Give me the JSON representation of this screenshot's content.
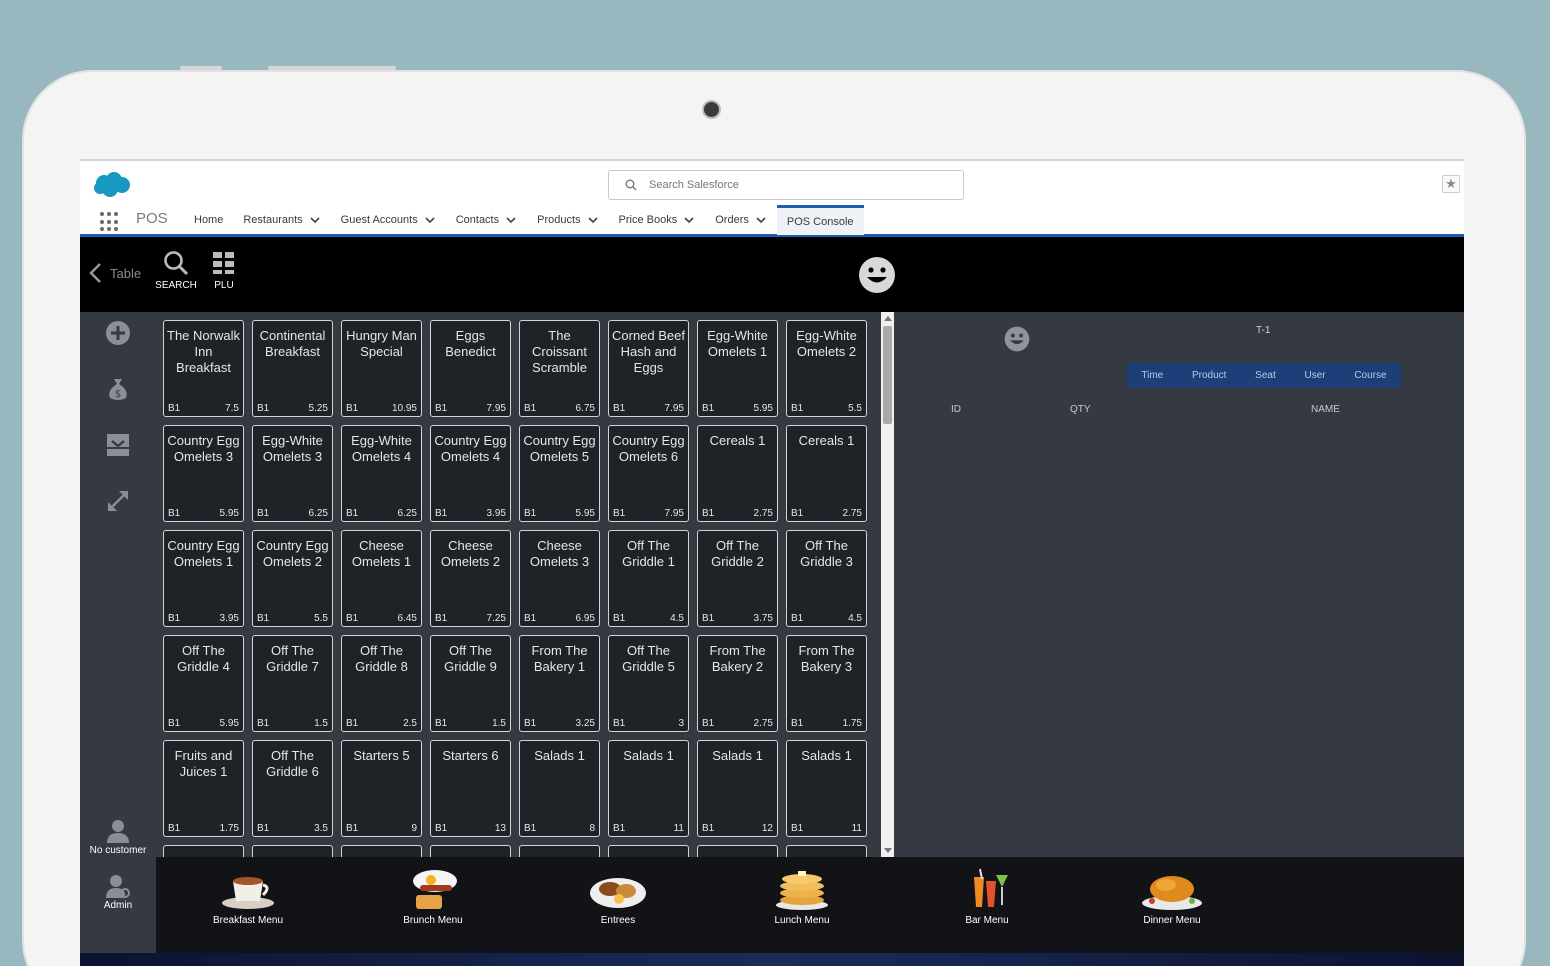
{
  "sf": {
    "search_placeholder": "Search Salesforce",
    "app_name": "POS",
    "nav": [
      {
        "label": "Home",
        "dropdown": false
      },
      {
        "label": "Restaurants",
        "dropdown": true
      },
      {
        "label": "Guest Accounts",
        "dropdown": true
      },
      {
        "label": "Contacts",
        "dropdown": true
      },
      {
        "label": "Products",
        "dropdown": true
      },
      {
        "label": "Price Books",
        "dropdown": true
      },
      {
        "label": "Orders",
        "dropdown": true
      },
      {
        "label": "POS Console",
        "dropdown": false,
        "active": true
      }
    ]
  },
  "toolbar": {
    "back_label": "Table",
    "search_label": "SEARCH",
    "plu_label": "PLU"
  },
  "rail": {
    "customer_label": "No customer",
    "admin_label": "Admin"
  },
  "tiles": [
    {
      "name": "The Norwalk Inn Breakfast",
      "code": "B1",
      "price": "7.5"
    },
    {
      "name": "Continental Breakfast",
      "code": "B1",
      "price": "5.25"
    },
    {
      "name": "Hungry Man Special",
      "code": "B1",
      "price": "10.95"
    },
    {
      "name": "Eggs Benedict",
      "code": "B1",
      "price": "7.95"
    },
    {
      "name": "The Croissant Scramble",
      "code": "B1",
      "price": "6.75"
    },
    {
      "name": "Corned Beef Hash and Eggs",
      "code": "B1",
      "price": "7.95"
    },
    {
      "name": "Egg-White Omelets 1",
      "code": "B1",
      "price": "5.95"
    },
    {
      "name": "Egg-White Omelets 2",
      "code": "B1",
      "price": "5.5"
    },
    {
      "name": "Country Egg Omelets 3",
      "code": "B1",
      "price": "5.95"
    },
    {
      "name": "Egg-White Omelets 3",
      "code": "B1",
      "price": "6.25"
    },
    {
      "name": "Egg-White Omelets 4",
      "code": "B1",
      "price": "6.25"
    },
    {
      "name": "Country Egg Omelets 4",
      "code": "B1",
      "price": "3.95"
    },
    {
      "name": "Country Egg Omelets 5",
      "code": "B1",
      "price": "5.95"
    },
    {
      "name": "Country Egg Omelets 6",
      "code": "B1",
      "price": "7.95"
    },
    {
      "name": "Cereals 1",
      "code": "B1",
      "price": "2.75"
    },
    {
      "name": "Cereals 1",
      "code": "B1",
      "price": "2.75"
    },
    {
      "name": "Country Egg Omelets 1",
      "code": "B1",
      "price": "3.95"
    },
    {
      "name": "Country Egg Omelets 2",
      "code": "B1",
      "price": "5.5"
    },
    {
      "name": "Cheese Omelets 1",
      "code": "B1",
      "price": "6.45"
    },
    {
      "name": "Cheese Omelets 2",
      "code": "B1",
      "price": "7.25"
    },
    {
      "name": "Cheese Omelets 3",
      "code": "B1",
      "price": "6.95"
    },
    {
      "name": "Off The Griddle 1",
      "code": "B1",
      "price": "4.5"
    },
    {
      "name": "Off The Griddle 2",
      "code": "B1",
      "price": "3.75"
    },
    {
      "name": "Off The Griddle 3",
      "code": "B1",
      "price": "4.5"
    },
    {
      "name": "Off The Griddle 4",
      "code": "B1",
      "price": "5.95"
    },
    {
      "name": "Off The Griddle 7",
      "code": "B1",
      "price": "1.5"
    },
    {
      "name": "Off The Griddle 8",
      "code": "B1",
      "price": "2.5"
    },
    {
      "name": "Off The Griddle 9",
      "code": "B1",
      "price": "1.5"
    },
    {
      "name": "From The Bakery 1",
      "code": "B1",
      "price": "3.25"
    },
    {
      "name": "Off The Griddle 5",
      "code": "B1",
      "price": "3"
    },
    {
      "name": "From The Bakery 2",
      "code": "B1",
      "price": "2.75"
    },
    {
      "name": "From The Bakery 3",
      "code": "B1",
      "price": "1.75"
    },
    {
      "name": "Fruits and Juices 1",
      "code": "B1",
      "price": "1.75"
    },
    {
      "name": "Off The Griddle 6",
      "code": "B1",
      "price": "3.5"
    },
    {
      "name": "Starters 5",
      "code": "B1",
      "price": "9"
    },
    {
      "name": "Starters 6",
      "code": "B1",
      "price": "13"
    },
    {
      "name": "Salads 1",
      "code": "B1",
      "price": "8"
    },
    {
      "name": "Salads 1",
      "code": "B1",
      "price": "11"
    },
    {
      "name": "Salads 1",
      "code": "B1",
      "price": "12"
    },
    {
      "name": "Salads 1",
      "code": "B1",
      "price": "11"
    },
    {
      "name": "",
      "code": "",
      "price": ""
    },
    {
      "name": "",
      "code": "",
      "price": ""
    },
    {
      "name": "",
      "code": "",
      "price": ""
    },
    {
      "name": "",
      "code": "",
      "price": ""
    },
    {
      "name": "",
      "code": "",
      "price": ""
    },
    {
      "name": "",
      "code": "",
      "price": ""
    },
    {
      "name": "",
      "code": "",
      "price": ""
    },
    {
      "name": "",
      "code": "",
      "price": ""
    }
  ],
  "order": {
    "table_label": "T-1",
    "tabs": [
      "Time",
      "Product",
      "Seat",
      "User",
      "Course"
    ],
    "columns": {
      "id": "ID",
      "qty": "QTY",
      "name": "NAME"
    }
  },
  "menus": [
    {
      "label": "Breakfast Menu",
      "icon": "coffee-cup-icon"
    },
    {
      "label": "Brunch Menu",
      "icon": "eggs-toast-icon"
    },
    {
      "label": "Entrees",
      "icon": "plate-icon"
    },
    {
      "label": "Lunch Menu",
      "icon": "pancakes-icon"
    },
    {
      "label": "Bar Menu",
      "icon": "cocktails-icon"
    },
    {
      "label": "Dinner Menu",
      "icon": "roast-chicken-icon"
    }
  ],
  "colors": {
    "background": "#98b7bf",
    "panel": "#353a42",
    "tile": "#1f2226",
    "brand_blue": "#1b5fb5",
    "tab_bar": "#1c3f7a"
  }
}
